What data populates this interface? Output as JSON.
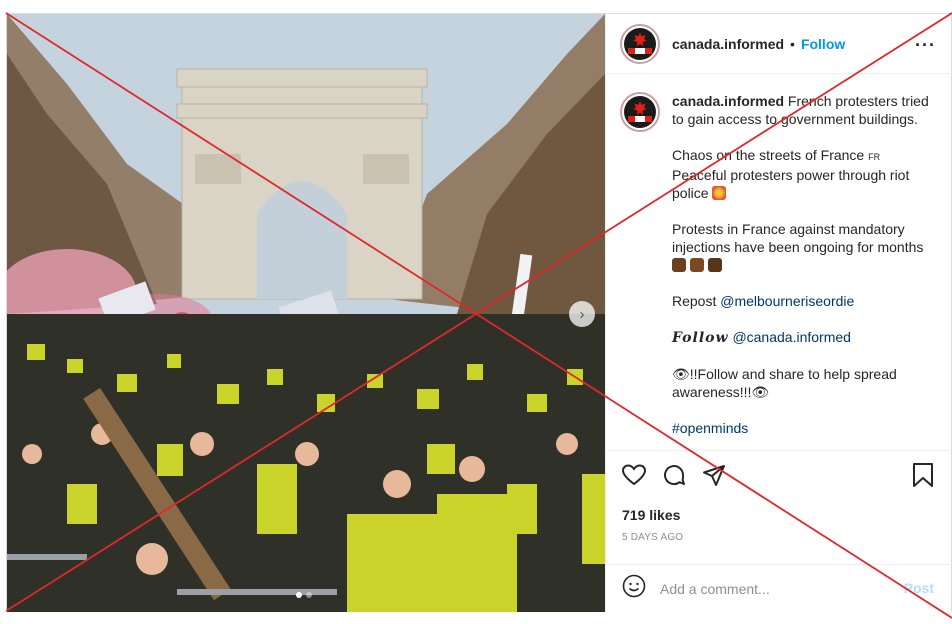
{
  "post": {
    "username": "canada.informed",
    "separator": "•",
    "follow_label": "Follow",
    "more_label": "•••"
  },
  "caption": {
    "username": "canada.informed",
    "line1": "French protesters tried to gain access to government buildings.",
    "line2": "Chaos on the streets of France",
    "flag_text": "FR",
    "line3": "Peaceful protesters power through riot police",
    "line4": "Protests in France against mandatory injections have been ongoing for months",
    "repost_prefix": "Repost",
    "repost_handle": "@melbourneriseordie",
    "follow_script": "Follow",
    "follow_handle": "@canada.informed",
    "share_text": "!!Follow and share to help spread awareness!!!",
    "hashtag": "#openminds"
  },
  "engagement": {
    "likes": "719 likes",
    "time": "5 days ago"
  },
  "comment": {
    "placeholder": "Add a comment...",
    "post_label": "Post"
  },
  "icons": {
    "like": "heart-icon",
    "comment": "comment-bubble-icon",
    "share": "paper-plane-icon",
    "save": "bookmark-icon",
    "emoji": "smiley-icon",
    "carousel": "chevron-right-icon"
  },
  "carousel": {
    "active_index": 1,
    "count": 2
  },
  "colors": {
    "accent": "#0095f6",
    "overlay_x": "#e0282a",
    "text": "#262626",
    "muted": "#8e8e8e"
  }
}
